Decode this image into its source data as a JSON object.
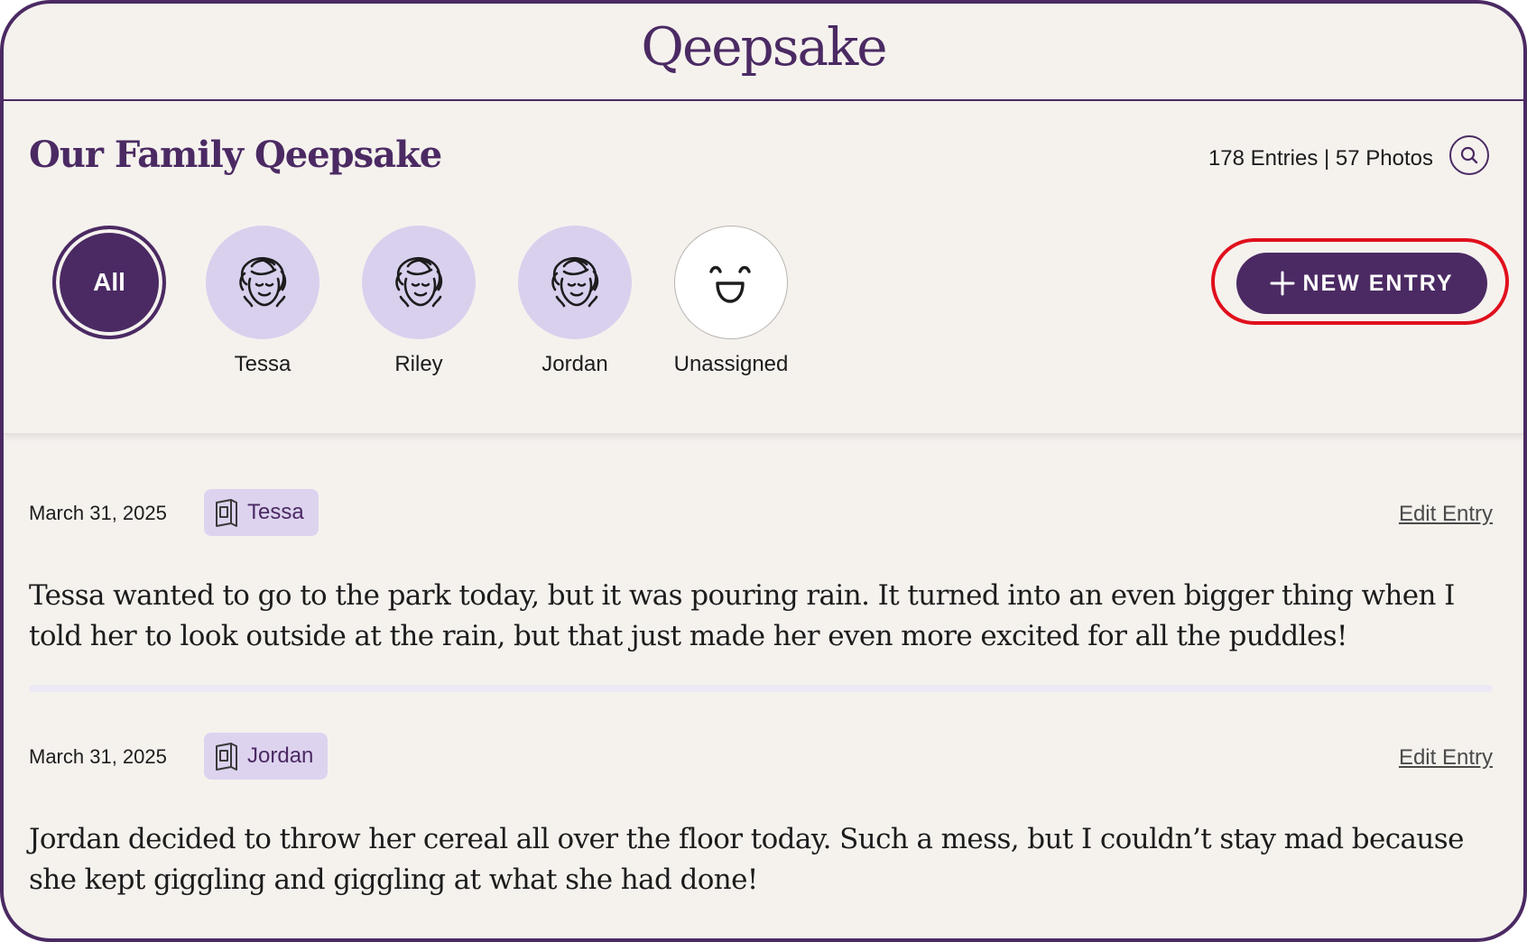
{
  "header": {
    "brand": "Qeepsake"
  },
  "top": {
    "title": "Our Family Qeepsake",
    "stats": "178 Entries | 57 Photos",
    "search_icon": "search-icon",
    "new_entry_label": "NEW ENTRY",
    "new_entry_icon": "plus-icon"
  },
  "filters": [
    {
      "label": "All",
      "icon": ""
    },
    {
      "label": "Tessa",
      "icon": "child-face-icon"
    },
    {
      "label": "Riley",
      "icon": "child-face-icon"
    },
    {
      "label": "Jordan",
      "icon": "child-face-icon"
    },
    {
      "label": "Unassigned",
      "icon": "smiley-face-icon"
    }
  ],
  "entries": [
    {
      "date": "March 31, 2025",
      "tag": "Tessa",
      "tag_icon": "book-icon",
      "edit_label": "Edit Entry",
      "text": "Tessa wanted to go to the park today, but it was pouring rain. It turned into an even bigger thing when I told her to look outside at the rain, but that just made her even more excited for all the puddles!"
    },
    {
      "date": "March 31, 2025",
      "tag": "Jordan",
      "tag_icon": "book-icon",
      "edit_label": "Edit Entry",
      "text": "Jordan decided to throw her cereal all over the floor today. Such a mess, but I couldn’t stay mad because she kept giggling and giggling at what she had done!"
    }
  ],
  "colors": {
    "brand": "#4b2a63",
    "background": "#f5f2ee",
    "avatar_bg": "#d9d0ee",
    "tag_bg": "#ddd3ef",
    "highlight": "#e0101c"
  }
}
